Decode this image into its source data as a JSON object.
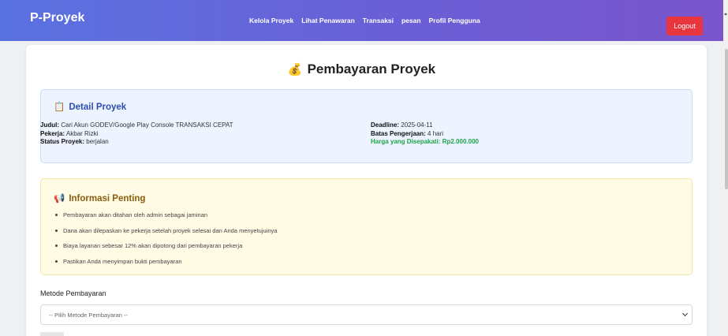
{
  "navbar": {
    "brand": "P-Proyek",
    "links": [
      "Kelola Proyek",
      "Lihat Penawaran",
      "Transaksi",
      "pesan",
      "Profil Pengguna"
    ],
    "logout_label": "Logout"
  },
  "page": {
    "title": "Pembayaran Proyek",
    "title_icon": "money-bag-icon"
  },
  "detail": {
    "heading": "Detail Proyek",
    "heading_icon": "clipboard-icon",
    "judul_label": "Judul:",
    "judul_value": "Cari Akun GODEV/Google Play Console TRANSAKSI CEPAT",
    "pekerja_label": "Pekerja:",
    "pekerja_value": "Akbar Rizki",
    "status_label": "Status Proyek:",
    "status_value": "berjalan",
    "deadline_label": "Deadline:",
    "deadline_value": "2025-04-11",
    "batas_label": "Batas Pengerjaan:",
    "batas_value": "4 hari",
    "harga_label": "Harga yang Disepakati:",
    "harga_value": "Rp2.000.000",
    "harga_color": "#1fa34a"
  },
  "info": {
    "heading": "Informasi Penting",
    "heading_icon": "megaphone-icon",
    "items": [
      "Pembayaran akan ditahan oleh admin sebagai jaminan",
      "Dana akan dilepaskan ke pekerja setelah proyek selesai dan Anda menyetujuinya",
      "Biaya layanan sebesar 12% akan dipotong dari pembayaran pekerja",
      "Pastikan Anda menyimpan bukti pembayaran"
    ]
  },
  "payment": {
    "method_label": "Metode Pembayaran",
    "method_selected": "-- Pilih Metode Pembayaran --"
  },
  "colors": {
    "nav_gradient_start": "#5a72e0",
    "nav_gradient_end": "#7a55cc",
    "logout_bg": "#e8353e",
    "detail_bg": "#edf3ff",
    "info_bg": "#fffbe5"
  }
}
